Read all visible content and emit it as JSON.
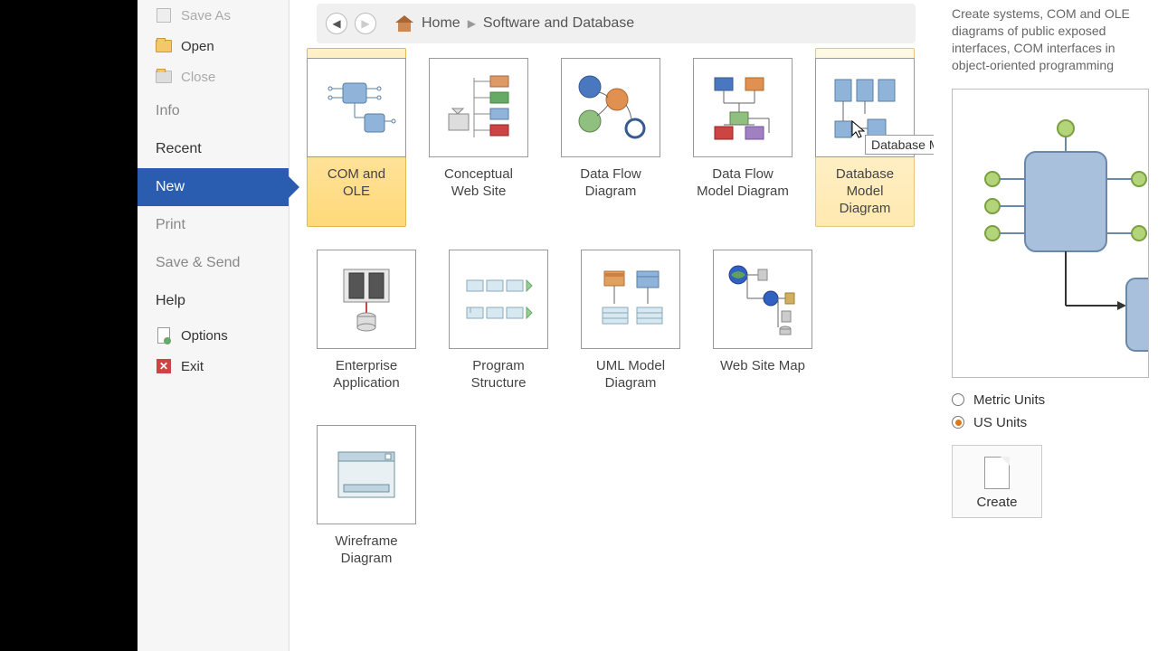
{
  "sidebar": {
    "save_as": "Save As",
    "open": "Open",
    "close": "Close",
    "info": "Info",
    "recent": "Recent",
    "new": "New",
    "print": "Print",
    "save_send": "Save & Send",
    "help": "Help",
    "options": "Options",
    "exit": "Exit"
  },
  "breadcrumb": {
    "home": "Home",
    "category": "Software and Database"
  },
  "templates": [
    {
      "label": "COM and OLE"
    },
    {
      "label": "Conceptual Web Site"
    },
    {
      "label": "Data Flow Diagram"
    },
    {
      "label": "Data Flow Model Diagram"
    },
    {
      "label": "Database Model Diagram"
    },
    {
      "label": "Enterprise Application"
    },
    {
      "label": "Program Structure"
    },
    {
      "label": "UML Model Diagram"
    },
    {
      "label": "Web Site Map"
    },
    {
      "label": "Wireframe Diagram"
    }
  ],
  "tooltip": "Database Model Diagram",
  "side_panel": {
    "description": "Create systems, COM and OLE diagrams of public exposed interfaces, COM interfaces in object-oriented programming",
    "metric": "Metric Units",
    "us": "US Units",
    "create": "Create"
  }
}
